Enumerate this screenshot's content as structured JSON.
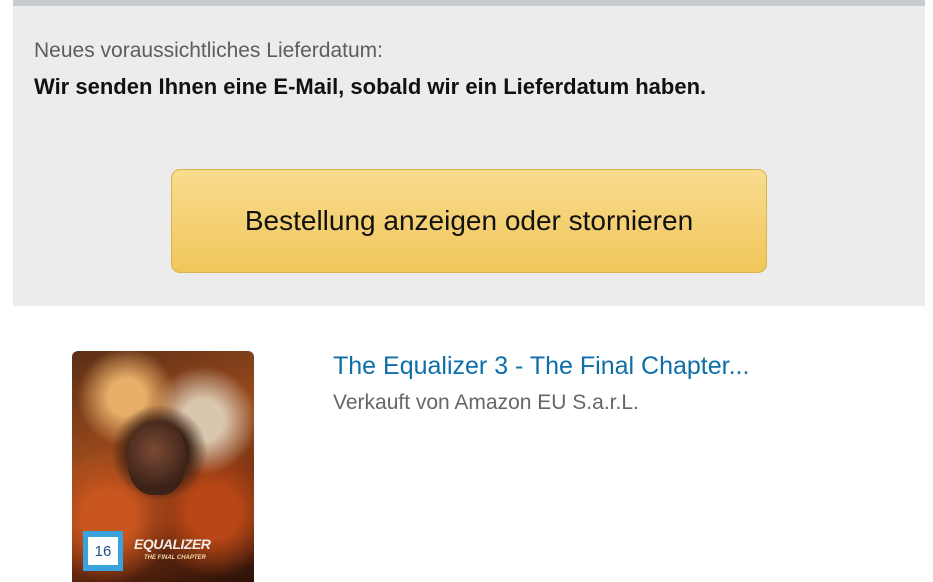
{
  "delivery": {
    "label": "Neues voraussichtliches Lieferdatum:",
    "message": "Wir senden Ihnen eine E-Mail, sobald wir ein Lieferdatum haben."
  },
  "order_button": {
    "label": "Bestellung anzeigen oder stornieren"
  },
  "product": {
    "title": "The Equalizer 3 - The Final Chapter...",
    "seller": "Verkauft von Amazon EU S.a.r.L.",
    "cover_title": "EQUALIZER",
    "cover_subtitle": "THE FINAL CHAPTER",
    "age_rating": "16"
  },
  "colors": {
    "panel_background": "#ececec",
    "button_background": "#f1c65b",
    "link": "#0f6ea8"
  }
}
